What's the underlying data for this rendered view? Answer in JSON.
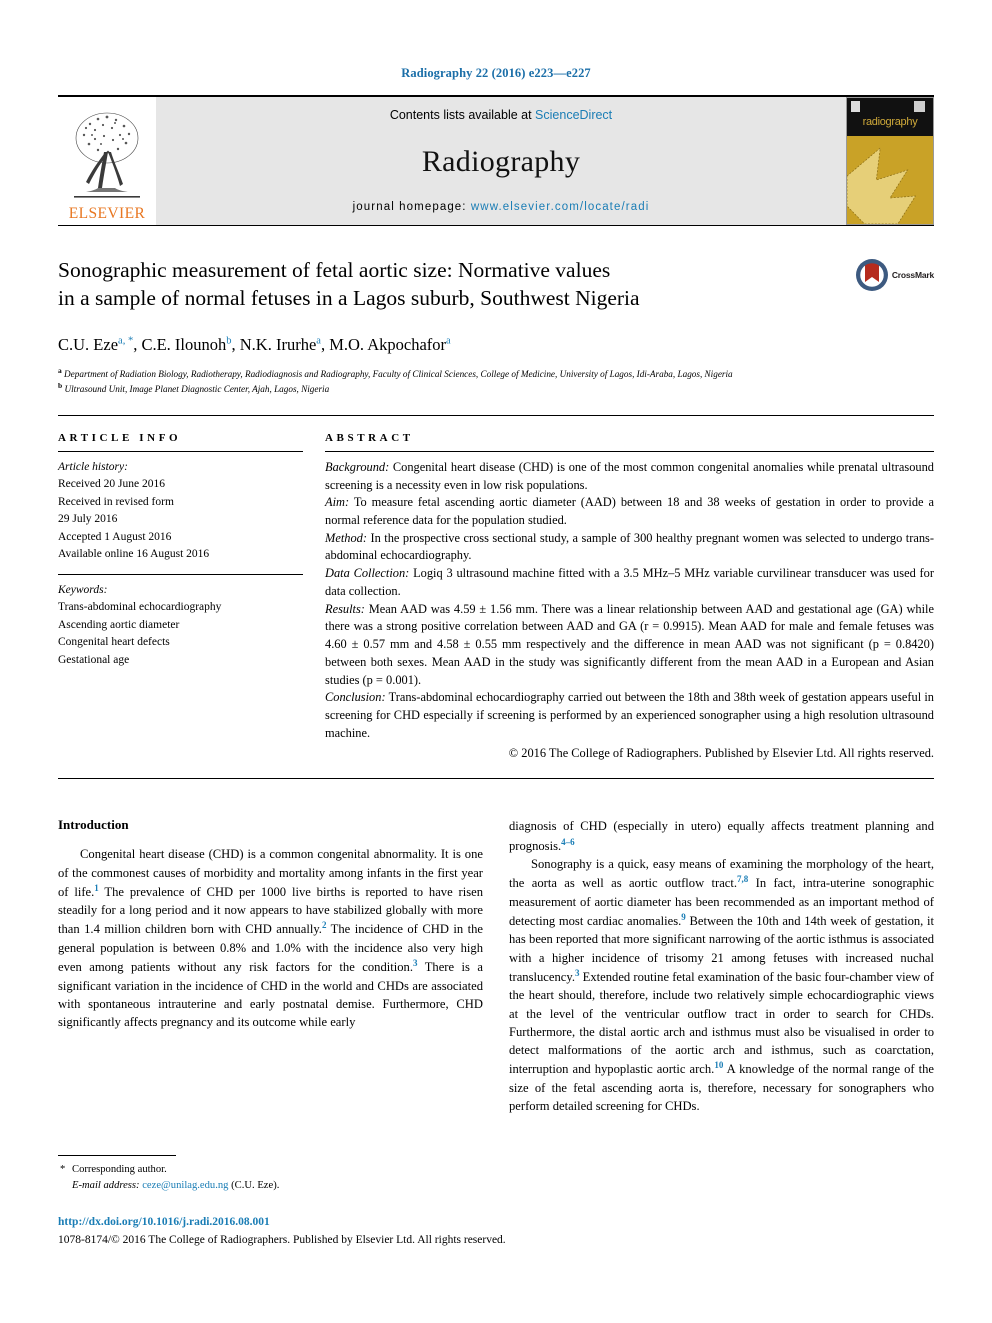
{
  "running_head": "Radiography 22 (2016) e223—e227",
  "masthead": {
    "contents_prefix": "Contents lists available at ",
    "contents_link": "ScienceDirect",
    "journal_name": "Radiography",
    "homepage_prefix": "journal homepage: ",
    "homepage_url": "www.elsevier.com/locate/radi",
    "publisher_logo_word": "ELSEVIER",
    "cover_title": "radiography"
  },
  "title": {
    "line1": "Sonographic measurement of fetal aortic size: Normative values",
    "line2": "in a sample of normal fetuses in a Lagos suburb, Southwest Nigeria",
    "crossmark_label": "CrossMark"
  },
  "authors": {
    "list": [
      {
        "name": "C.U. Eze",
        "marks": "a, *"
      },
      {
        "name": "C.E. Ilounoh",
        "marks": "b"
      },
      {
        "name": "N.K. Irurhe",
        "marks": "a"
      },
      {
        "name": "M.O. Akpochafor",
        "marks": "a"
      }
    ],
    "affiliation_a": "Department of Radiation Biology, Radiotherapy, Radiodiagnosis and Radiography, Faculty of Clinical Sciences, College of Medicine, University of Lagos, Idi-Araba, Lagos, Nigeria",
    "affiliation_b": "Ultrasound Unit, Image Planet Diagnostic Center, Ajah, Lagos, Nigeria"
  },
  "article_info": {
    "heading": "ARTICLE INFO",
    "history_label": "Article history:",
    "history": [
      "Received 20 June 2016",
      "Received in revised form",
      "29 July 2016",
      "Accepted 1 August 2016",
      "Available online 16 August 2016"
    ],
    "keywords_label": "Keywords:",
    "keywords": [
      "Trans-abdominal echocardiography",
      "Ascending aortic diameter",
      "Congenital heart defects",
      "Gestational age"
    ]
  },
  "abstract": {
    "heading": "ABSTRACT",
    "sections": [
      {
        "label": "Background:",
        "text": " Congenital heart disease (CHD) is one of the most common congenital anomalies while prenatal ultrasound screening is a necessity even in low risk populations."
      },
      {
        "label": "Aim:",
        "text": " To measure fetal ascending aortic diameter (AAD) between 18 and 38 weeks of gestation in order to provide a normal reference data for the population studied."
      },
      {
        "label": "Method:",
        "text": " In the prospective cross sectional study, a sample of 300 healthy pregnant women was selected to undergo trans-abdominal echocardiography."
      },
      {
        "label": "Data Collection:",
        "text": " Logiq 3 ultrasound machine fitted with a 3.5 MHz–5 MHz variable curvilinear transducer was used for data collection."
      },
      {
        "label": "Results:",
        "text": " Mean AAD was 4.59 ± 1.56 mm. There was a linear relationship between AAD and gestational age (GA) while there was a strong positive correlation between AAD and GA (r = 0.9915). Mean AAD for male and female fetuses was 4.60 ± 0.57 mm and 4.58 ± 0.55 mm respectively and the difference in mean AAD was not significant (p = 0.8420) between both sexes. Mean AAD in the study was significantly different from the mean AAD in a European and Asian studies (p = 0.001)."
      },
      {
        "label": "Conclusion:",
        "text": " Trans-abdominal echocardiography carried out between the 18th and 38th week of gestation appears useful in screening for CHD especially if screening is performed by an experienced sonographer using a high resolution ultrasound machine."
      }
    ],
    "copyright": "© 2016 The College of Radiographers. Published by Elsevier Ltd. All rights reserved."
  },
  "body": {
    "intro_heading": "Introduction",
    "left_paragraph_1_a": "Congenital heart disease (CHD) is a common congenital abnormality. It is one of the commonest causes of morbidity and mortality among infants in the first year of life.",
    "left_ref_1": "1",
    "left_paragraph_1_b": " The prevalence of CHD per 1000 live births is reported to have risen steadily for a long period and it now appears to have stabilized globally with more than 1.4 million children born with CHD annually.",
    "left_ref_2": "2",
    "left_paragraph_1_c": " The incidence of CHD in the general population is between 0.8% and 1.0% with the incidence also very high even among patients without any risk factors for the condition.",
    "left_ref_3": "3",
    "left_paragraph_1_d": " There is a significant variation in the incidence of CHD in the world and CHDs are associated with spontaneous intrauterine and early postnatal demise. Furthermore, CHD significantly affects pregnancy and its outcome while early",
    "right_paragraph_1_a": "diagnosis of CHD (especially in utero) equally affects treatment planning and prognosis.",
    "right_ref_46": "4–6",
    "right_paragraph_2_a": "Sonography is a quick, easy means of examining the morphology of the heart, the aorta as well as aortic outflow tract.",
    "right_ref_78": "7,8",
    "right_paragraph_2_b": " In fact, intra-uterine sonographic measurement of aortic diameter has been recommended as an important method of detecting most cardiac anomalies.",
    "right_ref_9": "9",
    "right_paragraph_2_c": " Between the 10th and 14th week of gestation, it has been reported that more significant narrowing of the aortic isthmus is associated with a higher incidence of trisomy 21 among fetuses with increased nuchal translucency.",
    "right_ref_3": "3",
    "right_paragraph_2_d": " Extended routine fetal examination of the basic four-chamber view of the heart should, therefore, include two relatively simple echocardiographic views at the level of the ventricular outflow tract in order to search for CHDs. Furthermore, the distal aortic arch and isthmus must also be visualised in order to detect malformations of the aortic arch and isthmus, such as coarctation, interruption and hypoplastic aortic arch.",
    "right_ref_10": "10",
    "right_paragraph_2_e": " A knowledge of the normal range of the size of the fetal ascending aorta is, therefore, necessary for sonographers who perform detailed screening for CHDs."
  },
  "footnote": {
    "star": "*",
    "corresponding": "Corresponding author.",
    "email_label": "E-mail address:",
    "email": "ceze@unilag.edu.ng",
    "email_owner": "(C.U. Eze)."
  },
  "footer": {
    "doi": "http://dx.doi.org/10.1016/j.radi.2016.08.001",
    "issn_line": "1078-8174/© 2016 The College of Radiographers. Published by Elsevier Ltd. All rights reserved."
  },
  "colors": {
    "link_blue": "#1a7db5",
    "elsevier_orange": "#E87722",
    "cover_gold": "#c9a227",
    "crossmark_red": "#b52b1e"
  }
}
